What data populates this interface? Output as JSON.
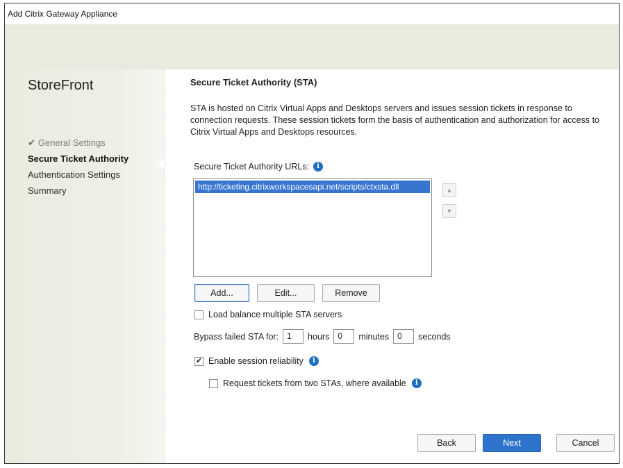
{
  "window": {
    "title": "Add Citrix Gateway Appliance"
  },
  "sidebar": {
    "product": "StoreFront",
    "items": [
      {
        "label": "General Settings",
        "state": "done",
        "icon": "check-icon"
      },
      {
        "label": "Secure Ticket Authority",
        "state": "active"
      },
      {
        "label": "Authentication Settings",
        "state": "pending"
      },
      {
        "label": "Summary",
        "state": "pending"
      }
    ]
  },
  "main": {
    "title": "Secure Ticket Authority (STA)",
    "description": "STA is hosted on Citrix Virtual Apps and Desktops servers and issues session tickets in response to connection requests. These session tickets form the basis of authentication and authorization for access to Citrix Virtual Apps and Desktops resources.",
    "urls_label": "Secure Ticket Authority URLs:",
    "urls": [
      "http://ticketing.citrixworkspacesapi.net/scripts/ctxsta.dll"
    ],
    "list_buttons": {
      "add": "Add...",
      "edit": "Edit...",
      "remove": "Remove"
    },
    "load_balance": {
      "label": "Load balance multiple STA servers",
      "checked": false
    },
    "bypass": {
      "label": "Bypass failed STA for:",
      "hours": "1",
      "hours_label": "hours",
      "minutes": "0",
      "minutes_label": "minutes",
      "seconds": "0",
      "seconds_label": "seconds"
    },
    "session_reliability": {
      "label": "Enable session reliability",
      "checked": true
    },
    "two_stas": {
      "label": "Request tickets from two STAs, where available",
      "checked": false
    }
  },
  "footer": {
    "back": "Back",
    "next": "Next",
    "cancel": "Cancel"
  },
  "colors": {
    "accent": "#2f74cc",
    "selection": "#3875d0",
    "info": "#1e6fbf",
    "sidebar": "#e9ecdf"
  },
  "icons": {
    "check": "check-icon",
    "info": "info-icon",
    "up": "arrow-up-icon",
    "down": "arrow-down-icon"
  }
}
